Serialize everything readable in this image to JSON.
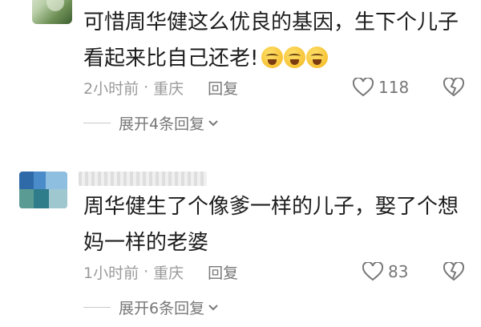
{
  "comments": [
    {
      "text_line1": "可惜周华健这么优良的基因，生下个儿子",
      "text_line2": "看起来比自己还老!",
      "emojis": [
        "crying-laughing-emoji",
        "crying-emoji",
        "crying-emoji"
      ],
      "time": "2小时前",
      "separator": "·",
      "location": "重庆",
      "reply_label": "回复",
      "likes": "118",
      "expand_label": "展开4条回复"
    },
    {
      "text_line1": "周华健生了个像爹一样的儿子，娶了个想",
      "text_line2": "妈一样的老婆",
      "time": "1小时前",
      "separator": "·",
      "location": "重庆",
      "reply_label": "回复",
      "likes": "83",
      "expand_label": "展开6条回复"
    }
  ]
}
